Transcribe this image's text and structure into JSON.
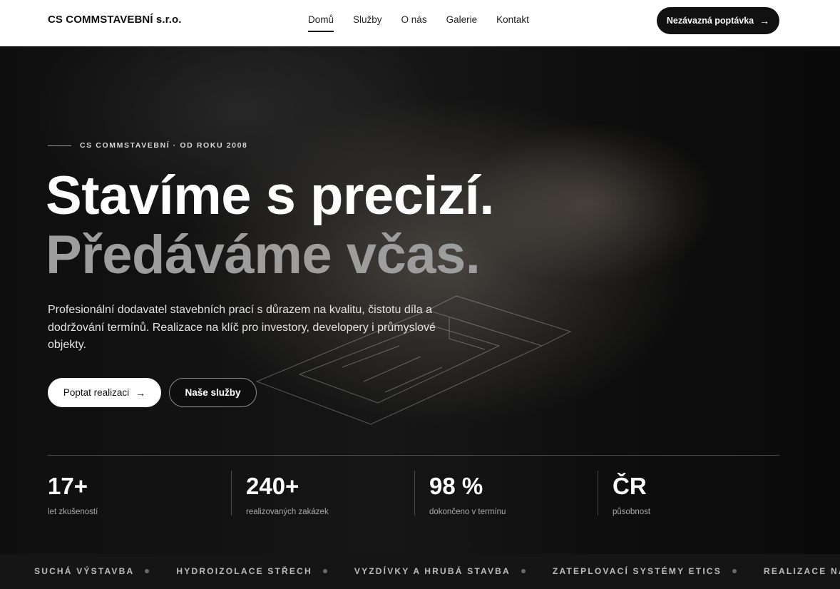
{
  "header": {
    "logo": "CS COMMSTAVEBNÍ s.r.o.",
    "nav": [
      {
        "label": "Domů",
        "active": true
      },
      {
        "label": "Služby",
        "active": false
      },
      {
        "label": "O nás",
        "active": false
      },
      {
        "label": "Galerie",
        "active": false
      },
      {
        "label": "Kontakt",
        "active": false
      }
    ],
    "cta_label": "Nezávazná poptávka",
    "cta_icon": "arrow-right-icon"
  },
  "hero": {
    "eyebrow": "CS COMMSTAVEBNÍ · OD ROKU 2008",
    "title_line1": "Stavíme s precizí.",
    "title_line2": "Předáváme včas.",
    "lead": "Profesionální dodavatel stavebních prací s důrazem na kvalitu, čistotu díla a dodržování termínů. Realizace na klíč pro investory, developery i průmyslové objekty.",
    "primary_button": "Poptat realizaci",
    "secondary_button": "Naše služby"
  },
  "stats": [
    {
      "value": "17+",
      "label": "let zkušeností"
    },
    {
      "value": "240+",
      "label": "realizovaných zakázek"
    },
    {
      "value": "98 %",
      "label": "dokončeno v termínu"
    },
    {
      "value": "ČR",
      "label": "působnost"
    }
  ],
  "ticker": [
    "SUCHÁ VÝSTAVBA",
    "HYDROIZOLACE STŘECH",
    "VYZDÍVKY A HRUBÁ STAVBA",
    "ZATEPLOVACÍ SYSTÉMY ETICS",
    "REALIZACE NA KLÍČ"
  ],
  "colors": {
    "accent": "#111111",
    "hero_title_muted": "#9d9d9d",
    "background": "#111111"
  }
}
